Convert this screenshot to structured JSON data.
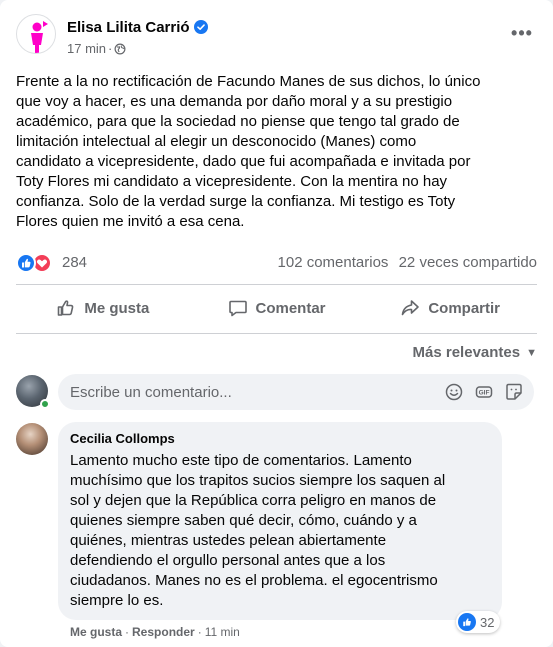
{
  "post": {
    "author": "Elisa Lilita Carrió",
    "time": "17 min",
    "meta_separator": "·",
    "more_label": "•••",
    "text": "Frente a la no rectificación de Facundo Manes de sus dichos, lo único\nque voy a hacer, es una demanda por daño moral y a su prestigio\nacadémico, para que la sociedad no piense que tengo tal grado de\nlimitación intelectual al elegir un desconocido (Manes) como\ncandidato a vicepresidente, dado que fui acompañada e invitada por\nToty Flores mi candidato a vicepresidente. Con la mentira no hay\nconfianza. Solo de la verdad surge la confianza. Mi testigo es Toty\nFlores quien me invitó a esa cena.",
    "reaction_count": "284",
    "comments_count": "102 comentarios",
    "shares_count": "22 veces compartido",
    "avatar_color": "#ff00c8",
    "verified_color": "#1877f2"
  },
  "actions": {
    "like_label": "Me gusta",
    "comment_label": "Comentar",
    "share_label": "Compartir"
  },
  "sort": {
    "label": "Más relevantes"
  },
  "comment_box": {
    "placeholder": "Escribe un comentario..."
  },
  "comment": {
    "author": "Cecilia Collomps",
    "text": "Lamento mucho este tipo de comentarios. Lamento\nmuchísimo que los trapitos sucios siempre los saquen al\nsol y dejen que la República corra peligro en manos de\nquienes siempre saben qué decir, cómo, cuándo y a\nquiénes, mientras ustedes pelean abiertamente\ndefendiendo el orgullo personal antes que a los\nciudadanos. Manes no es el problema. el egocentrismo\nsiempre lo es.",
    "like_label": "Me gusta",
    "reply_label": "Responder",
    "time": "11 min",
    "separator": "·",
    "reaction_count": "32"
  },
  "colors": {
    "like_blue": "#1877f2",
    "love_red": "#f33e58",
    "secondary_text": "#65676b",
    "bubble_bg": "#f0f2f5"
  },
  "icons": {
    "verified": "verified-badge-icon",
    "globe": "globe-icon",
    "like": "thumbs-up-icon",
    "comment": "speech-bubble-icon",
    "share": "share-arrow-icon",
    "emoji": "emoji-icon",
    "gif": "gif-icon",
    "sticker": "sticker-icon"
  }
}
